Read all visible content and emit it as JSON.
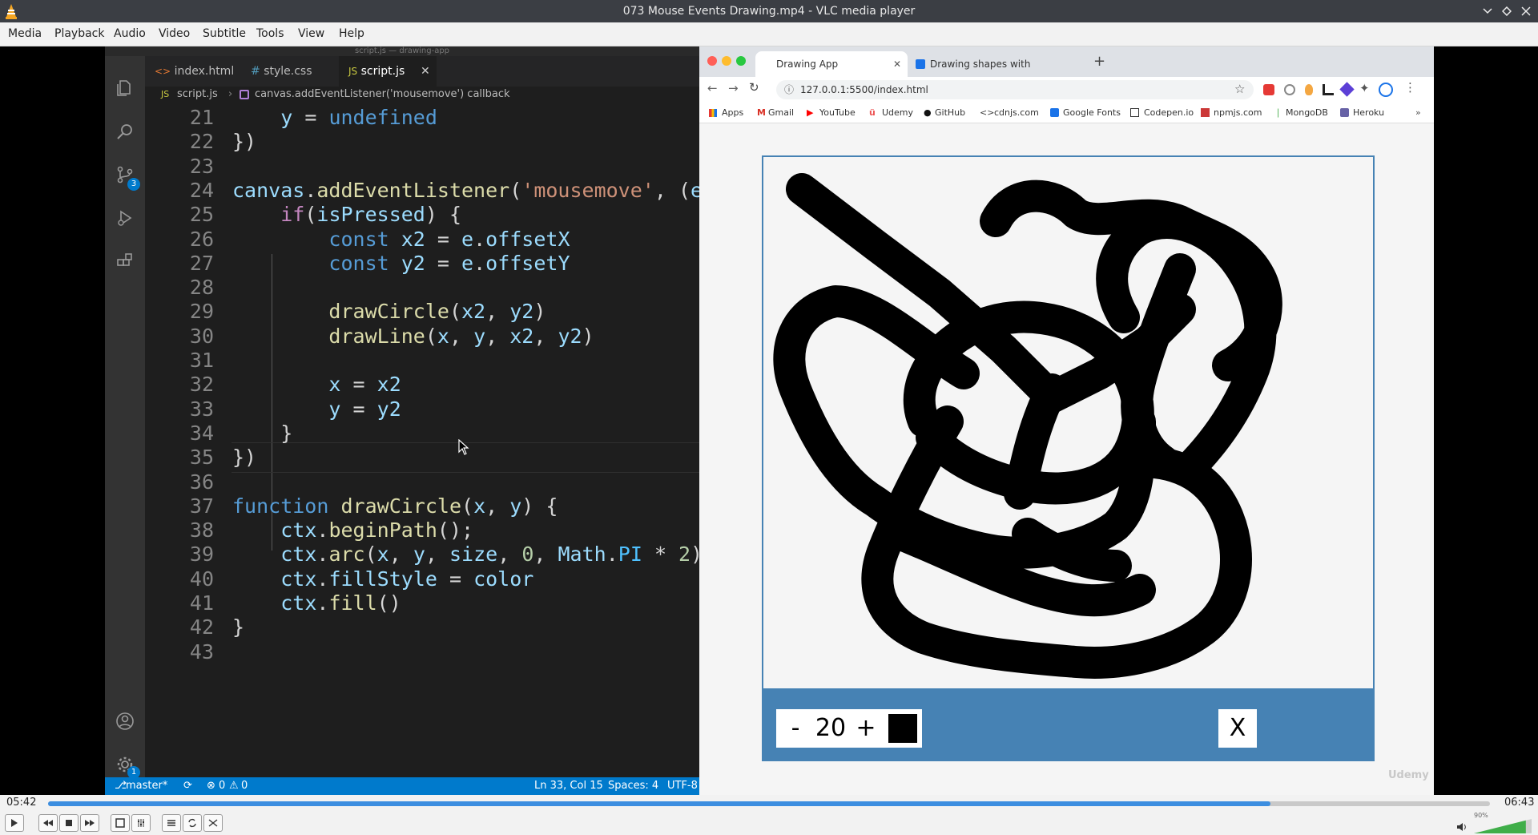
{
  "window": {
    "title": "073 Mouse Events Drawing.mp4 - VLC media player",
    "controls": [
      "minimize-icon",
      "restore-icon",
      "close-icon"
    ]
  },
  "menu": [
    "Media",
    "Playback",
    "Audio",
    "Video",
    "Subtitle",
    "Tools",
    "View",
    "Help"
  ],
  "editor": {
    "window_title": "script.js — drawing-app",
    "tabs": [
      {
        "label": "index.html",
        "icon": "html-file-icon"
      },
      {
        "label": "style.css",
        "icon": "css-file-icon"
      },
      {
        "label": "script.js",
        "icon": "js-file-icon",
        "active": true
      }
    ],
    "breadcrumb": {
      "file": "script.js",
      "symbol": "canvas.addEventListener('mousemove') callback"
    },
    "activity_badges": {
      "scm": "3",
      "settings": "1"
    },
    "code_lines": [
      {
        "n": "21",
        "text": "    y = undefined"
      },
      {
        "n": "22",
        "text": "})"
      },
      {
        "n": "23",
        "text": ""
      },
      {
        "n": "24",
        "text": "canvas.addEventListener('mousemove', (e"
      },
      {
        "n": "25",
        "text": "    if(isPressed) {"
      },
      {
        "n": "26",
        "text": "        const x2 = e.offsetX"
      },
      {
        "n": "27",
        "text": "        const y2 = e.offsetY"
      },
      {
        "n": "28",
        "text": ""
      },
      {
        "n": "29",
        "text": "        drawCircle(x2, y2)"
      },
      {
        "n": "30",
        "text": "        drawLine(x, y, x2, y2)"
      },
      {
        "n": "31",
        "text": ""
      },
      {
        "n": "32",
        "text": "        x = x2"
      },
      {
        "n": "33",
        "text": "        y = y2"
      },
      {
        "n": "34",
        "text": "    }"
      },
      {
        "n": "35",
        "text": "})"
      },
      {
        "n": "36",
        "text": ""
      },
      {
        "n": "37",
        "text": "function drawCircle(x, y) {"
      },
      {
        "n": "38",
        "text": "    ctx.beginPath();"
      },
      {
        "n": "39",
        "text": "    ctx.arc(x, y, size, 0, Math.PI * 2)"
      },
      {
        "n": "40",
        "text": "    ctx.fillStyle = color"
      },
      {
        "n": "41",
        "text": "    ctx.fill()"
      },
      {
        "n": "42",
        "text": "}"
      },
      {
        "n": "43",
        "text": ""
      }
    ],
    "status": {
      "branch": "master*",
      "problems": "0",
      "warnings": "0",
      "position": "Ln 33, Col 15",
      "spaces": "Spaces: 4",
      "encoding": "UTF-8"
    }
  },
  "browser": {
    "tabs": [
      {
        "label": "Drawing App",
        "active": true
      },
      {
        "label": "Drawing shapes with canvas -"
      }
    ],
    "url": "127.0.0.1:5500/index.html",
    "bookmarks": [
      "Apps",
      "Gmail",
      "YouTube",
      "Udemy",
      "GitHub",
      "cdnjs.com",
      "Google Fonts",
      "Codepen.io",
      "npmjs.com",
      "MongoDB",
      "Heroku"
    ],
    "watermark": "Udemy"
  },
  "drawing_app": {
    "decrease_label": "-",
    "size_value": "20",
    "increase_label": "+",
    "color_value": "#000000",
    "clear_label": "X",
    "accent": "#4682b4"
  },
  "player": {
    "elapsed": "05:42",
    "total": "06:43",
    "progress": 0.848,
    "volume_label": "90%",
    "volume": 0.9
  }
}
